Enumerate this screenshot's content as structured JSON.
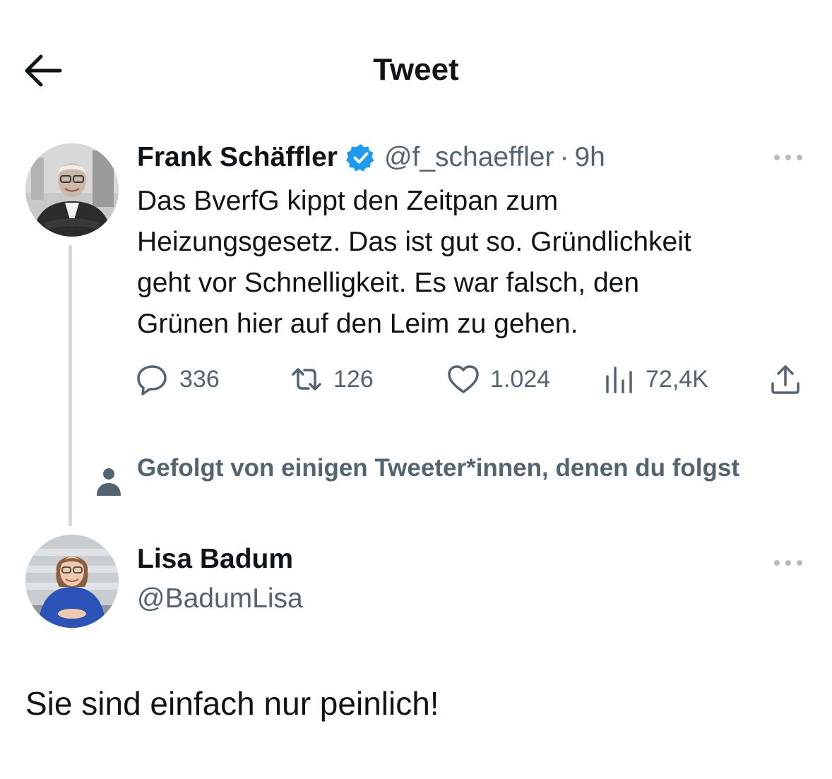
{
  "header": {
    "title": "Tweet",
    "back_icon": "arrow-left-icon"
  },
  "thread": {
    "parent": {
      "author_name": "Frank Schäffler",
      "verified": true,
      "handle": "@f_schaeffler",
      "separator": "·",
      "time": "9h",
      "text": "Das BverfG kippt den Zeitpan zum\nHeizungsgesetz. Das ist gut so. Gründlichkeit\ngeht vor Schnelligkeit. Es war falsch, den\nGrünen hier auf den Leim zu gehen.",
      "actions": {
        "replies": "336",
        "retweets": "126",
        "likes": "1.024",
        "views": "72,4K"
      }
    },
    "social_context": "Gefolgt von einigen Tweeter*innen, denen du folgst",
    "main": {
      "author_name": "Lisa Badum",
      "handle": "@BadumLisa",
      "text": "Sie sind einfach nur peinlich!"
    }
  },
  "colors": {
    "accent": "#1d9bf0",
    "text": "#0f1419",
    "secondary": "#536471",
    "line": "#cfd9de"
  }
}
